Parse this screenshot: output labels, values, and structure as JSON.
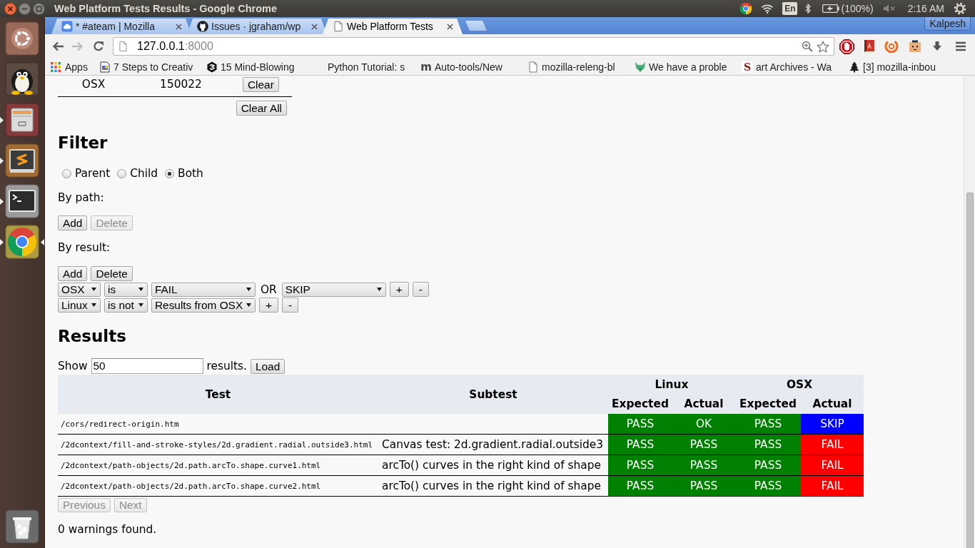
{
  "window": {
    "title": "Web Platform Tests Results - Google Chrome"
  },
  "top_panel": {
    "keyboard": "En",
    "battery": "(100%)",
    "clock": "2:16 AM"
  },
  "launcher": {
    "items": [
      {
        "kind": "dash",
        "running": false,
        "focused": false
      },
      {
        "kind": "penguin",
        "running": false,
        "focused": false
      },
      {
        "kind": "files",
        "running": true,
        "focused": false
      },
      {
        "kind": "editor",
        "running": true,
        "focused": false
      },
      {
        "kind": "terminal",
        "running": true,
        "focused": false
      },
      {
        "kind": "browser",
        "running": true,
        "focused": true
      },
      {
        "kind": "trash",
        "running": false,
        "focused": false
      }
    ]
  },
  "browser": {
    "tabs": [
      {
        "kind": "cloud",
        "label": "* #ateam | Mozilla",
        "selected": false
      },
      {
        "kind": "cat",
        "label": "Issues · jgraham/wp",
        "selected": false
      },
      {
        "kind": "page",
        "label": "Web Platform Tests",
        "selected": true
      }
    ],
    "profile": "Kalpesh",
    "address": {
      "host": "127.0.0.1",
      "port": ":8000"
    },
    "bookmarks": [
      {
        "kind": "apps",
        "label": "Apps"
      },
      {
        "kind": "picture",
        "label": "7 Steps to Creativ"
      },
      {
        "kind": "hexagon",
        "label": "15 Mind-Blowing"
      },
      {
        "kind": "none",
        "label": "Python Tutorial: s"
      },
      {
        "kind": "letter",
        "favicon_text": "m",
        "label": "Auto-tools/New"
      },
      {
        "kind": "page",
        "label": "mozilla-releng-bl"
      },
      {
        "kind": "fox",
        "label": "We have a proble"
      },
      {
        "kind": "serif",
        "favicon_text": "S",
        "label": "art Archives - Wa"
      },
      {
        "kind": "tree",
        "label": "[3] mozilla-inbou"
      }
    ]
  },
  "page": {
    "runs": {
      "rows": [
        {
          "platform": "OSX",
          "run": "150022",
          "button": "Clear"
        }
      ],
      "clear_all": "Clear All"
    },
    "filter": {
      "heading": "Filter",
      "scope": [
        {
          "label": "Parent",
          "selected": false
        },
        {
          "label": "Child",
          "selected": false
        },
        {
          "label": "Both",
          "selected": true
        }
      ],
      "by_path": {
        "label": "By path:",
        "buttons": [
          {
            "label": "Add",
            "disabled": false
          },
          {
            "label": "Delete",
            "disabled": true
          }
        ]
      },
      "by_result": {
        "label": "By result:",
        "buttons": [
          {
            "label": "Add",
            "disabled": false
          },
          {
            "label": "Delete",
            "disabled": false
          }
        ],
        "conditions": [
          {
            "parts": [
              {
                "kind": "platform",
                "text": "OSX"
              },
              {
                "kind": "operator",
                "text": "is"
              },
              {
                "kind": "value",
                "text": "FAIL"
              },
              {
                "kind": "joiner",
                "text": "OR"
              },
              {
                "kind": "value",
                "text": "SKIP"
              },
              {
                "kind": "button",
                "text": "+"
              },
              {
                "kind": "button",
                "text": "-"
              }
            ]
          },
          {
            "parts": [
              {
                "kind": "platform",
                "text": "Linux"
              },
              {
                "kind": "operator",
                "text": "is not"
              },
              {
                "kind": "value",
                "text": "Results from OSX"
              },
              {
                "kind": "button",
                "text": "+"
              },
              {
                "kind": "button",
                "text": "-"
              }
            ]
          }
        ]
      }
    },
    "results": {
      "heading": "Results",
      "show": {
        "label": "Show",
        "value": "50",
        "suffix": "results.",
        "button": "Load"
      },
      "table": {
        "columns": [
          "Test",
          "Subtest"
        ],
        "groups": [
          {
            "name": "Linux",
            "columns": [
              "Expected",
              "Actual"
            ]
          },
          {
            "name": "OSX",
            "columns": [
              "Expected",
              "Actual"
            ]
          }
        ],
        "rows": [
          {
            "test": "/cors/redirect-origin.htm",
            "results": [
              {
                "text": "PASS",
                "color": "#008000"
              },
              {
                "text": "OK",
                "color": "#008000"
              },
              {
                "text": "PASS",
                "color": "#008000"
              },
              {
                "text": "SKIP",
                "color": "#0000ff"
              }
            ]
          },
          {
            "test": "/2dcontext/fill-and-stroke-styles/2d.gradient.radial.outside3.html",
            "subtest": "Canvas test: 2d.gradient.radial.outside3",
            "results": [
              {
                "text": "PASS",
                "color": "#008000"
              },
              {
                "text": "PASS",
                "color": "#008000"
              },
              {
                "text": "PASS",
                "color": "#008000"
              },
              {
                "text": "FAIL",
                "color": "#ff0000"
              }
            ]
          },
          {
            "test": "/2dcontext/path-objects/2d.path.arcTo.shape.curve1.html",
            "subtest": "arcTo() curves in the right kind of shape",
            "results": [
              {
                "text": "PASS",
                "color": "#008000"
              },
              {
                "text": "PASS",
                "color": "#008000"
              },
              {
                "text": "PASS",
                "color": "#008000"
              },
              {
                "text": "FAIL",
                "color": "#ff0000"
              }
            ]
          },
          {
            "test": "/2dcontext/path-objects/2d.path.arcTo.shape.curve2.html",
            "subtest": "arcTo() curves in the right kind of shape",
            "results": [
              {
                "text": "PASS",
                "color": "#008000"
              },
              {
                "text": "PASS",
                "color": "#008000"
              },
              {
                "text": "PASS",
                "color": "#008000"
              },
              {
                "text": "FAIL",
                "color": "#ff0000"
              }
            ]
          }
        ]
      },
      "pager": [
        {
          "label": "Previous",
          "disabled": true
        },
        {
          "label": "Next",
          "disabled": true
        }
      ],
      "warnings": "0 warnings found."
    }
  }
}
